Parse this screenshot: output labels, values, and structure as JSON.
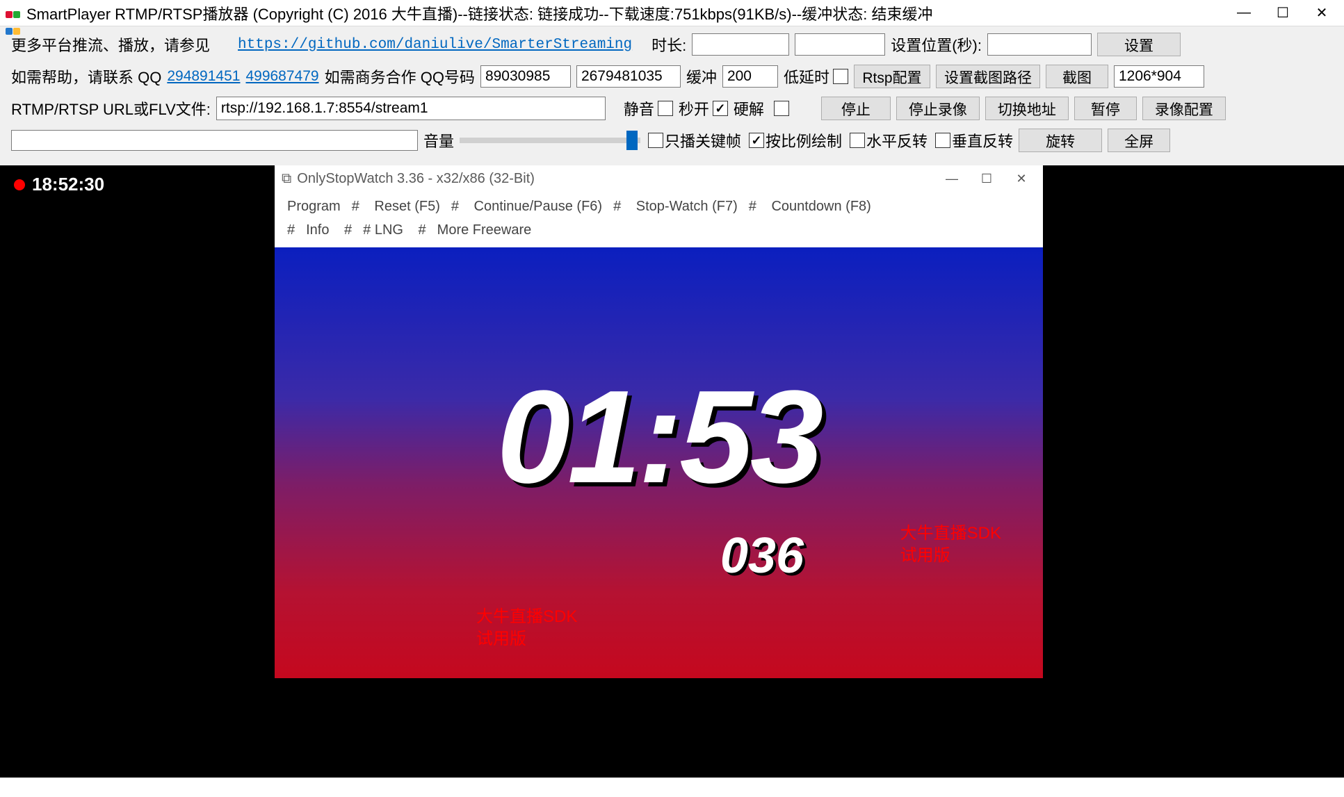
{
  "title": "SmartPlayer RTMP/RTSP播放器 (Copyright (C) 2016 大牛直播)--链接状态: 链接成功--下载速度:751kbps(91KB/s)--缓冲状态: 结束缓冲",
  "row1": {
    "more_label": "更多平台推流、播放，请参见",
    "github_url": "https://github.com/daniulive/SmarterStreaming",
    "duration_label": "时长:",
    "duration_value": "",
    "position_value": "",
    "setpos_label": "设置位置(秒):",
    "setpos_value": "",
    "set_btn": "设置"
  },
  "row2": {
    "help_label": "如需帮助，请联系 QQ",
    "qq1": "294891451",
    "qq2": "499687479",
    "biz_label": "如需商务合作 QQ号码",
    "biz1": "89030985",
    "biz2": "2679481035",
    "buffer_label": "缓冲",
    "buffer_value": "200",
    "lowlat_label": "低延时",
    "rtsp_btn": "Rtsp配置",
    "snap_path_btn": "设置截图路径",
    "snap_btn": "截图",
    "resolution": "1206*904"
  },
  "row3": {
    "url_label": "RTMP/RTSP URL或FLV文件:",
    "url_value": "rtsp://192.168.1.7:8554/stream1",
    "mute_label": "静音",
    "fastopen_label": "秒开",
    "hw_label": "硬解",
    "stop_btn": "停止",
    "stoprec_btn": "停止录像",
    "switch_btn": "切换地址",
    "pause_btn": "暂停",
    "reccfg_btn": "录像配置"
  },
  "row4": {
    "volume_label": "音量",
    "keyframe_label": "只播关键帧",
    "scale_label": "按比例绘制",
    "hflip_label": "水平反转",
    "vflip_label": "垂直反转",
    "rotate_btn": "旋转",
    "fullscreen_btn": "全屏"
  },
  "video": {
    "clock": "18:52:30"
  },
  "stopwatch": {
    "title": "OnlyStopWatch 3.36 - x32/x86 (32-Bit)",
    "menu": [
      "Program",
      "#",
      "Reset (F5)",
      "#",
      "Continue/Pause (F6)",
      "#",
      "Stop-Watch (F7)",
      "#",
      "Countdown (F8)",
      "#",
      "Info",
      "#",
      "# LNG",
      "#",
      "More Freeware"
    ],
    "time": "01:53",
    "ms": "036",
    "watermark1_l1": "大牛直播SDK",
    "watermark1_l2": "试用版",
    "watermark2_l1": "大牛直播SDK",
    "watermark2_l2": "试用版"
  }
}
